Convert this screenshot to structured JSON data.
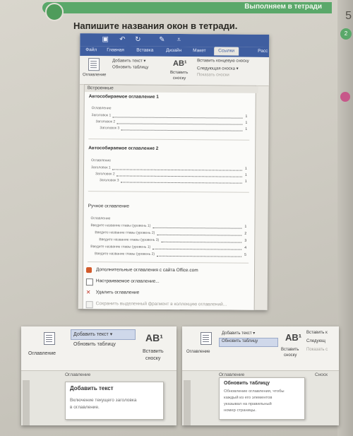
{
  "header": {
    "banner_text": "Выполняем в тетради",
    "side_number": "5",
    "side_badge": "2"
  },
  "instruction": "Напишите названия окон в тетради.",
  "word": {
    "tabs": [
      {
        "label": "Файл"
      },
      {
        "label": "Главная"
      },
      {
        "label": "Вставка"
      },
      {
        "label": "Дизайн"
      },
      {
        "label": "Макет"
      },
      {
        "label": "Ссылки",
        "active": true
      },
      {
        "label": "Расс"
      }
    ],
    "ribbon": {
      "toc_button": "Оглавление",
      "add_text": "Добавить текст ▾",
      "update_table": "Обновить таблицу",
      "insert_footnote_line1": "Вставить",
      "insert_footnote_line2": "сноску",
      "ab_label": "AB¹",
      "insert_endnote": "Вставить концевую сноску",
      "next_footnote": "Следующая сноска ▾",
      "show_notes": "Показать сноски"
    },
    "dropdown": {
      "builtin_header": "Встроенные",
      "auto1_title": "Автособираемое оглавление 1",
      "auto2_title": "Автособираемое оглавление 2",
      "manual_title": "Ручное оглавление",
      "toc_caption": "Оглавление",
      "headings": [
        "Заголовок 1",
        "Заголовок 2",
        "Заголовок 3"
      ],
      "heading_nums": [
        "1",
        "1",
        "1"
      ],
      "manual_entries": [
        "Введите название главы (уровень 1)",
        "Введите название главы (уровень 2)",
        "Введите название главы (уровень 3)",
        "Введите название главы (уровень 1)",
        "Введите название главы (уровень 2)"
      ],
      "manual_nums": [
        "1",
        "2",
        "3",
        "4",
        "5"
      ],
      "menu": [
        "Дополнительные оглавления с сайта Office.com",
        "Настраиваемое оглавление...",
        "Удалить оглавление",
        "Сохранить выделенный фрагмент в коллекцию оглавлений..."
      ]
    }
  },
  "bottom_left": {
    "toc_button": "Оглавление",
    "add_text": "Добавить текст ▾",
    "update_table": "Обновить таблицу",
    "ab_label": "AB¹",
    "insert_line1": "Вставить",
    "insert_line2": "сноску",
    "group_label": "Оглавление",
    "tip_title": "Добавить текст",
    "tip_body_line1": "Включение текущего заголовка",
    "tip_body_line2": "в оглавление."
  },
  "bottom_right": {
    "toc_button": "Оглавление",
    "add_text": "Добавить текст ▾",
    "update_table": "Обновить таблицу",
    "ab_label": "AB¹",
    "insert_line1": "Вставить",
    "insert_line2": "сноску",
    "insert_short": "Вставить к",
    "next_short": "Следующ",
    "show_short": "Показать с",
    "group_label": "Оглавление",
    "group_label2": "Сноск",
    "tip_title": "Обновить таблицу",
    "tip_body": [
      "Обновление оглавления, чтобы",
      "каждый из его элементов",
      "указывал на правильный",
      "номер страницы."
    ]
  },
  "colors": {
    "word_blue": "#3f5ea0",
    "banner_green": "#5aa86a",
    "accent_pink": "#c7588a"
  }
}
